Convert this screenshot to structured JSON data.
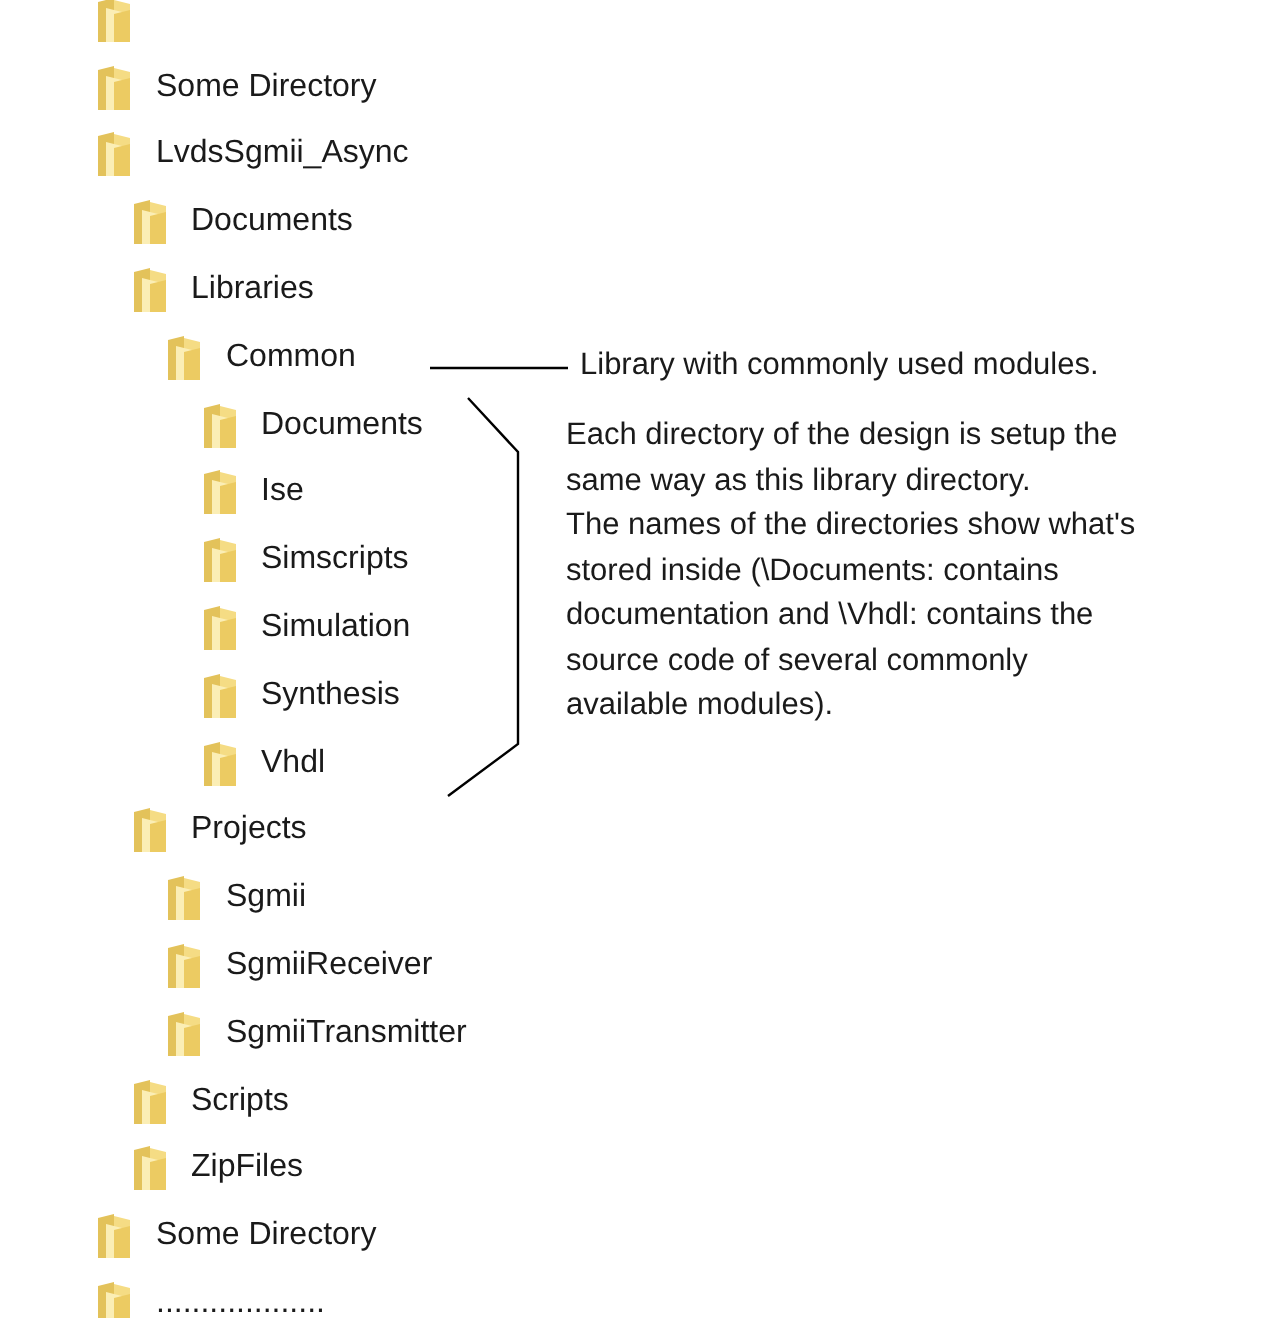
{
  "tree": [
    {
      "kind": "folder"
    },
    {
      "kind": "folder",
      "label": "Some Directory"
    },
    {
      "kind": "folder",
      "label": "LvdsSgmii_Async",
      "children": [
        {
          "kind": "folder",
          "label": "Documents"
        },
        {
          "kind": "folder",
          "label": "Libraries",
          "children": [
            {
              "kind": "folder",
              "label": "Common",
              "children": [
                {
                  "kind": "folder",
                  "label": "Documents"
                },
                {
                  "kind": "folder",
                  "label": "Ise"
                },
                {
                  "kind": "folder",
                  "label": "Simscripts"
                },
                {
                  "kind": "folder",
                  "label": "Simulation"
                },
                {
                  "kind": "folder",
                  "label": "Synthesis"
                },
                {
                  "kind": "folder",
                  "label": "Vhdl"
                }
              ]
            }
          ]
        },
        {
          "kind": "folder",
          "label": "Projects",
          "children": [
            {
              "kind": "folder",
              "label": "Sgmii"
            },
            {
              "kind": "folder",
              "label": "SgmiiReceiver"
            },
            {
              "kind": "folder",
              "label": "SgmiiTransmitter"
            }
          ]
        },
        {
          "kind": "folder",
          "label": "Scripts"
        },
        {
          "kind": "folder",
          "label": "ZipFiles"
        }
      ]
    },
    {
      "kind": "folder",
      "label": "Some Directory"
    },
    {
      "kind": "folder",
      "label": "..................."
    }
  ],
  "annotations": {
    "library_note": "Library with commonly used modules.",
    "structure_note": "Each directory of the design is setup the\nsame way as this library directory.\nThe names of the directories show what's\nstored inside (\\Documents: contains\ndocumentation and \\Vhdl: contains the\nsource code of several commonly\navailable modules)."
  }
}
